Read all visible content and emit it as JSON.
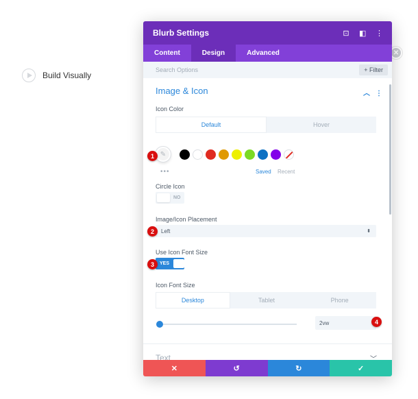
{
  "background": {
    "build_visually_label": "Build Visually",
    "play_icon": "play-circle-icon",
    "close_icon": "close-circle-icon"
  },
  "modal": {
    "title": "Blurb Settings",
    "header_icons": [
      "target-icon",
      "split-view-icon",
      "more-vertical-icon"
    ],
    "tabs": [
      {
        "label": "Content",
        "active": false
      },
      {
        "label": "Design",
        "active": true
      },
      {
        "label": "Advanced",
        "active": false
      }
    ],
    "search": {
      "placeholder": "Search Options",
      "filter_label": "+ Filter"
    }
  },
  "section": {
    "title": "Image & Icon",
    "icon_color": {
      "label": "Icon Color",
      "toggle": [
        "Default",
        "Hover"
      ],
      "active": "Default",
      "swatches": [
        "#000000",
        "#ffffff",
        "#e02b20",
        "#e09900",
        "#edf000",
        "#7cda24",
        "#0c71c3",
        "#8300e9"
      ],
      "more": "•••",
      "saved": "Saved",
      "recent": "Recent"
    },
    "circle_icon": {
      "label": "Circle Icon",
      "value": "NO"
    },
    "placement": {
      "label": "Image/Icon Placement",
      "value": "Left"
    },
    "use_icon_font_size": {
      "label": "Use Icon Font Size",
      "value": "YES"
    },
    "icon_font_size": {
      "label": "Icon Font Size",
      "devices": [
        "Desktop",
        "Tablet",
        "Phone"
      ],
      "active": "Desktop",
      "value": "2vw"
    }
  },
  "next_section": {
    "title": "Text"
  },
  "footer": {
    "cancel": "✕",
    "undo": "↺",
    "redo": "↻",
    "save": "✓"
  },
  "markers": [
    "1",
    "2",
    "3",
    "4"
  ],
  "colors": {
    "header": "#6c2eb9",
    "tabs": "#8240d8",
    "accent": "#2b87da",
    "cancel": "#ef5555",
    "undo": "#7e3bd0",
    "redo": "#2b87da",
    "save": "#29c4a9",
    "marker": "#d90f0f"
  }
}
